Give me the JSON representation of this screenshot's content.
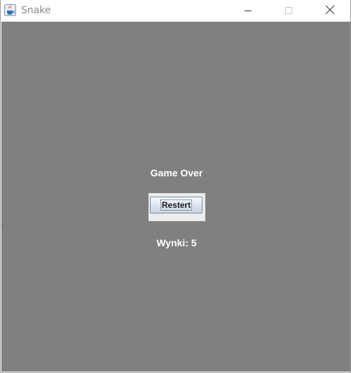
{
  "window": {
    "title": "Snake",
    "icon": "java-cup-icon",
    "controls": [
      "minimize-icon",
      "maximize-icon",
      "close-icon"
    ]
  },
  "game": {
    "status_text": "Game Over",
    "restart_label": "Restert",
    "score_text": "Wynki: 5"
  },
  "colors": {
    "board": "#808080",
    "text": "#ffffff",
    "button_panel": "#ececec"
  }
}
